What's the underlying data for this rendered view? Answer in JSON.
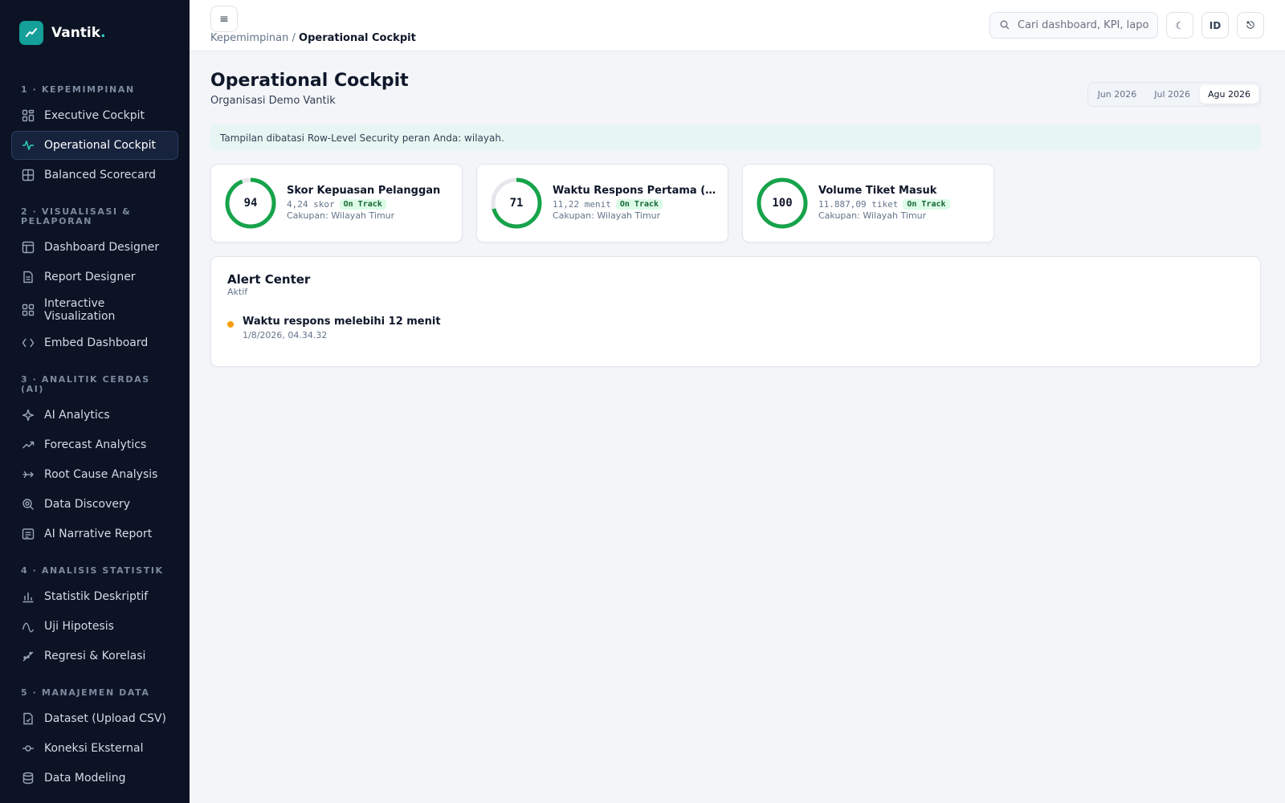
{
  "brand": {
    "name": "Vantik",
    "dot": ".",
    "accent": "#14a098"
  },
  "sidebar": {
    "sections": [
      {
        "title": "1 · KEPEMIMPINAN",
        "items": [
          {
            "label": "Executive Cockpit",
            "icon": "grid-icon"
          },
          {
            "label": "Operational Cockpit",
            "icon": "pulse-icon",
            "active": true
          },
          {
            "label": "Balanced Scorecard",
            "icon": "table-grid-icon"
          }
        ]
      },
      {
        "title": "2 · VISUALISASI & PELAPORAN",
        "items": [
          {
            "label": "Dashboard Designer",
            "icon": "layout-icon"
          },
          {
            "label": "Report Designer",
            "icon": "file-text-icon"
          },
          {
            "label": "Interactive Visualization",
            "icon": "grid-icon"
          },
          {
            "label": "Embed Dashboard",
            "icon": "code-icon"
          }
        ]
      },
      {
        "title": "3 · ANALITIK CERDAS (AI)",
        "items": [
          {
            "label": "AI Analytics",
            "icon": "sparkle-icon"
          },
          {
            "label": "Forecast Analytics",
            "icon": "trend-up-icon"
          },
          {
            "label": "Root Cause Analysis",
            "icon": "split-arrow-icon"
          },
          {
            "label": "Data Discovery",
            "icon": "search-zoom-icon"
          },
          {
            "label": "AI Narrative Report",
            "icon": "narrative-icon"
          }
        ]
      },
      {
        "title": "4 · ANALISIS STATISTIK",
        "items": [
          {
            "label": "Statistik Deskriptif",
            "icon": "bar-chart-icon"
          },
          {
            "label": "Uji Hipotesis",
            "icon": "wave-icon"
          },
          {
            "label": "Regresi & Korelasi",
            "icon": "scatter-trend-icon"
          }
        ]
      },
      {
        "title": "5 · MANAJEMEN DATA",
        "items": [
          {
            "label": "Dataset (Upload CSV)",
            "icon": "file-csv-icon"
          },
          {
            "label": "Koneksi Eksternal",
            "icon": "connection-icon"
          },
          {
            "label": "Data Modeling",
            "icon": "database-icon"
          }
        ]
      }
    ]
  },
  "header": {
    "menu_glyph": "≡",
    "breadcrumb_parent": "Kepemimpinan",
    "breadcrumb_sep": " / ",
    "breadcrumb_current": "Operational Cockpit",
    "search_placeholder": "Cari dashboard, KPI, lapo",
    "theme_glyph": "☾",
    "language": "ID",
    "logout_glyph": "⎋"
  },
  "page": {
    "title": "Operational Cockpit",
    "subtitle": "Organisasi Demo Vantik",
    "periods": [
      {
        "label": "Jun 2026"
      },
      {
        "label": "Jul 2026"
      },
      {
        "label": "Agu 2026",
        "active": true
      }
    ],
    "rls_notice": "Tampilan dibatasi Row-Level Security peran Anda: wilayah."
  },
  "kpis": [
    {
      "score": "94",
      "percent": 94,
      "name": "Skor Kepuasan Pelanggan",
      "value": "4,24 skor",
      "status": "On Track",
      "scope": "Cakupan: Wilayah Timur"
    },
    {
      "score": "71",
      "percent": 71,
      "name": "Waktu Respons Pertama (menit)",
      "value": "11,22 menit",
      "status": "On Track",
      "scope": "Cakupan: Wilayah Timur"
    },
    {
      "score": "100",
      "percent": 100,
      "name": "Volume Tiket Masuk",
      "value": "11.887,09 tiket",
      "status": "On Track",
      "scope": "Cakupan: Wilayah Timur"
    }
  ],
  "colors": {
    "gauge_fill": "#16a34a",
    "gauge_track": "#e5e7eb",
    "alert_dot": "#f59e0b"
  },
  "alerts": {
    "title": "Alert Center",
    "status": "Aktif",
    "items": [
      {
        "message": "Waktu respons melebihi 12 menit",
        "time": "1/8/2026, 04.34.32"
      }
    ]
  }
}
